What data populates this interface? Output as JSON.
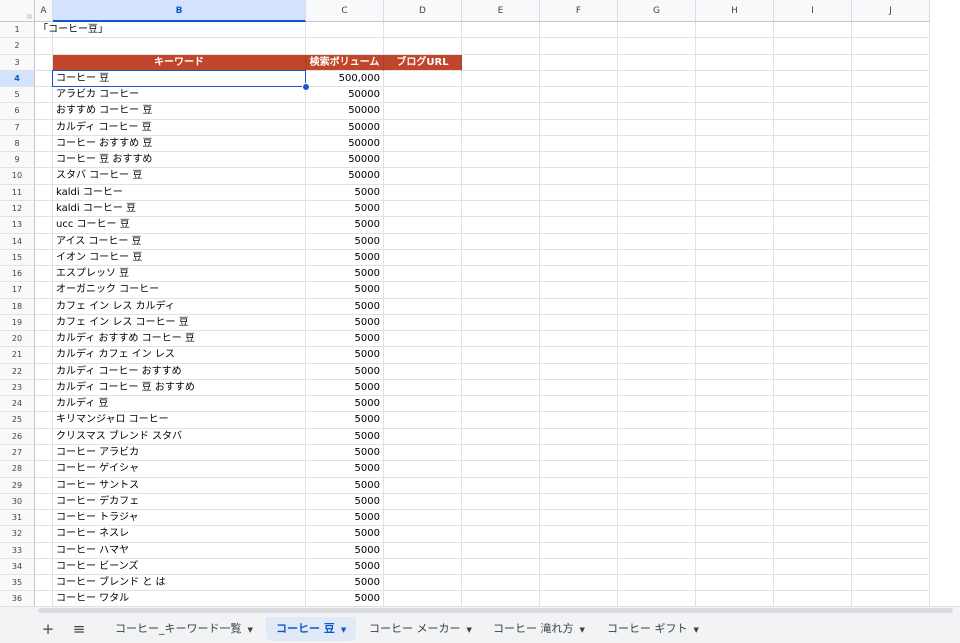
{
  "grid": {
    "columns": [
      "A",
      "B",
      "C",
      "D",
      "E",
      "F",
      "G",
      "H",
      "I",
      "J"
    ],
    "active_column": "B",
    "active_row": 4,
    "title_row": 1,
    "title_text": "「コーヒー豆」",
    "header_row": 3,
    "headers": {
      "keyword": "キーワード",
      "volume": "検索ボリューム",
      "blog_url": "ブログURL"
    },
    "header_color": "#c0462b",
    "first_data_row": 4,
    "rows": [
      {
        "keyword": "コーヒー 豆",
        "volume": "500,000"
      },
      {
        "keyword": "アラビカ コーヒー",
        "volume": "50000"
      },
      {
        "keyword": "おすすめ コーヒー 豆",
        "volume": "50000"
      },
      {
        "keyword": "カルディ コーヒー 豆",
        "volume": "50000"
      },
      {
        "keyword": "コーヒー おすすめ 豆",
        "volume": "50000"
      },
      {
        "keyword": "コーヒー 豆 おすすめ",
        "volume": "50000"
      },
      {
        "keyword": "スタバ コーヒー 豆",
        "volume": "50000"
      },
      {
        "keyword": "kaldi コーヒー",
        "volume": "5000"
      },
      {
        "keyword": "kaldi コーヒー 豆",
        "volume": "5000"
      },
      {
        "keyword": "ucc コーヒー 豆",
        "volume": "5000"
      },
      {
        "keyword": "アイス コーヒー 豆",
        "volume": "5000"
      },
      {
        "keyword": "イオン コーヒー 豆",
        "volume": "5000"
      },
      {
        "keyword": "エスプレッソ 豆",
        "volume": "5000"
      },
      {
        "keyword": "オーガニック コーヒー",
        "volume": "5000"
      },
      {
        "keyword": "カフェ イン レス カルディ",
        "volume": "5000"
      },
      {
        "keyword": "カフェ イン レス コーヒー 豆",
        "volume": "5000"
      },
      {
        "keyword": "カルディ おすすめ コーヒー 豆",
        "volume": "5000"
      },
      {
        "keyword": "カルディ カフェ イン レス",
        "volume": "5000"
      },
      {
        "keyword": "カルディ コーヒー おすすめ",
        "volume": "5000"
      },
      {
        "keyword": "カルディ コーヒー 豆 おすすめ",
        "volume": "5000"
      },
      {
        "keyword": "カルディ 豆",
        "volume": "5000"
      },
      {
        "keyword": "キリマンジャロ コーヒー",
        "volume": "5000"
      },
      {
        "keyword": "クリスマス ブレンド スタバ",
        "volume": "5000"
      },
      {
        "keyword": "コーヒー アラビカ",
        "volume": "5000"
      },
      {
        "keyword": "コーヒー ゲイシャ",
        "volume": "5000"
      },
      {
        "keyword": "コーヒー サントス",
        "volume": "5000"
      },
      {
        "keyword": "コーヒー デカフェ",
        "volume": "5000"
      },
      {
        "keyword": "コーヒー トラジャ",
        "volume": "5000"
      },
      {
        "keyword": "コーヒー ネスレ",
        "volume": "5000"
      },
      {
        "keyword": "コーヒー ハマヤ",
        "volume": "5000"
      },
      {
        "keyword": "コーヒー ビーンズ",
        "volume": "5000"
      },
      {
        "keyword": "コーヒー ブレンド と は",
        "volume": "5000"
      },
      {
        "keyword": "コーヒー ワタル",
        "volume": "5000"
      }
    ],
    "total_visible_rows": 36
  },
  "tab_bar": {
    "add_sheet_icon": "plus-icon",
    "all_sheets_icon": "hamburger-menu-icon",
    "add_sheet_glyph": "+",
    "all_sheets_glyph": "≡",
    "caret_glyph": "▼",
    "active_index": 1,
    "tabs": [
      {
        "label": "コーヒー_キーワード一覧"
      },
      {
        "label": "コーヒー 豆"
      },
      {
        "label": "コーヒー メーカー"
      },
      {
        "label": "コーヒー 滝れ方"
      },
      {
        "label": "コーヒー ギフト"
      }
    ]
  }
}
